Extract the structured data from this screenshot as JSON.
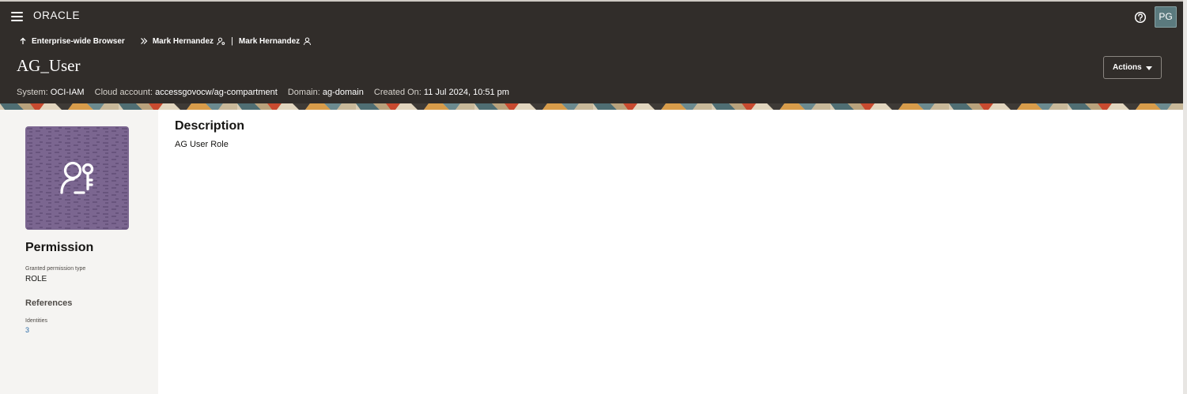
{
  "header": {
    "brand": "ORACLE",
    "avatar_initials": "PG",
    "help_icon": "help-circle-icon",
    "menu_icon": "hamburger-icon"
  },
  "breadcrumb": {
    "back_label": "Enterprise-wide Browser",
    "items": [
      {
        "label": "Mark Hernandez",
        "icon": "user-key-icon"
      },
      {
        "label": "Mark Hernandez",
        "icon": "user-icon"
      }
    ],
    "separator": "|"
  },
  "page": {
    "title": "AG_User",
    "actions_label": "Actions"
  },
  "meta": {
    "system_label": "System:",
    "system_value": "OCI-IAM",
    "cloud_label": "Cloud account:",
    "cloud_value": "accessgovocw/ag-compartment",
    "domain_label": "Domain:",
    "domain_value": "ag-domain",
    "created_label": "Created On:",
    "created_value": "11 Jul 2024, 10:51 pm"
  },
  "side": {
    "tile_icon": "user-key-icon",
    "tile_color": "#7b6690",
    "title": "Permission",
    "granted_label": "Granted permission type",
    "granted_value": "ROLE",
    "references_title": "References",
    "identities_label": "Identities",
    "identities_value": "3"
  },
  "main": {
    "description_title": "Description",
    "description_text": "AG User Role"
  },
  "colors": {
    "header_bg": "#312d2a",
    "side_bg": "#f5f4f2",
    "link": "#2b6ca8"
  }
}
